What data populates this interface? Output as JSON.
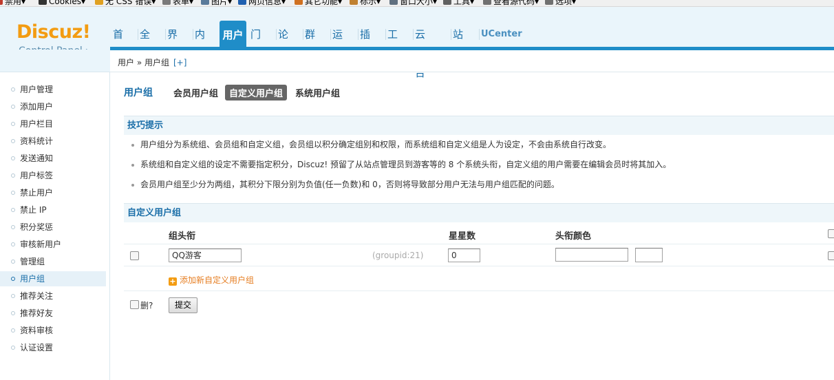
{
  "devbar": {
    "items": [
      {
        "label": "禁用▾",
        "icon": "forbid-icon",
        "color": "#c0392b"
      },
      {
        "label": "Cookies▾",
        "icon": "user-icon",
        "color": "#333333"
      },
      {
        "label": "无 CSS 错误▾",
        "icon": "pencil-icon",
        "color": "#e0a020"
      },
      {
        "label": "表单▾",
        "icon": "form-icon",
        "color": "#7a7a7a"
      },
      {
        "label": "图片▾",
        "icon": "image-icon",
        "color": "#5a7a9a"
      },
      {
        "label": "网页信息▾",
        "icon": "info-icon",
        "color": "#2060b0"
      },
      {
        "label": "其它功能▾",
        "icon": "tools-box-icon",
        "color": "#d07020"
      },
      {
        "label": "标示▾",
        "icon": "marker-icon",
        "color": "#c08030"
      },
      {
        "label": "窗口大小▾",
        "icon": "window-icon",
        "color": "#607080"
      },
      {
        "label": "工具▾",
        "icon": "wrench-icon",
        "color": "#606060"
      },
      {
        "label": "查看源代码▾",
        "icon": "source-icon",
        "color": "#707070"
      },
      {
        "label": "选项▾",
        "icon": "options-icon",
        "color": "#707070"
      }
    ]
  },
  "logo": {
    "main": "Discuz!",
    "sub": "Control Panel"
  },
  "nav": {
    "items": [
      "首页",
      "全局",
      "界面",
      "内容",
      "用户",
      "门户",
      "论坛",
      "群组",
      "运营",
      "插件",
      "工具",
      "云平台",
      "站长",
      "UCenter"
    ],
    "active": "用户"
  },
  "breadcrumb": {
    "path": "用户 » 用户组",
    "add": "[+]"
  },
  "sidebar": {
    "items": [
      "用户管理",
      "添加用户",
      "用户栏目",
      "资料统计",
      "发送通知",
      "用户标签",
      "禁止用户",
      "禁止 IP",
      "积分奖惩",
      "审核新用户",
      "管理组",
      "用户组",
      "推荐关注",
      "推荐好友",
      "资料审核",
      "认证设置"
    ],
    "active": "用户组"
  },
  "subtabs": {
    "title": "用户组",
    "tabs": [
      "会员用户组",
      "自定义用户组",
      "系统用户组"
    ],
    "active": "自定义用户组"
  },
  "tips": {
    "title": "技巧提示",
    "items": [
      "用户组分为系统组、会员组和自定义组，会员组以积分确定组别和权限，而系统组和自定义组是人为设定，不会由系统自行改变。",
      "系统组和自定义组的设定不需要指定积分，Discuz! 预留了从站点管理员到游客等的 8 个系统头衔，自定义组的用户需要在编辑会员时将其加入。",
      "会员用户组至少分为两组，其积分下限分别为负值(任一负数)和 0，否则将导致部分用户无法与用户组匹配的问题。"
    ]
  },
  "custom_groups": {
    "title": "自定义用户组",
    "headers": {
      "name": "组头衔",
      "stars": "星星数",
      "color": "头衔颜色"
    },
    "rows": [
      {
        "name": "QQ游客",
        "groupid": "(groupid:21)",
        "stars": "0",
        "color": ""
      }
    ],
    "add_label": "添加新自定义用户组",
    "delete_label": "删?",
    "submit_label": "提交"
  }
}
